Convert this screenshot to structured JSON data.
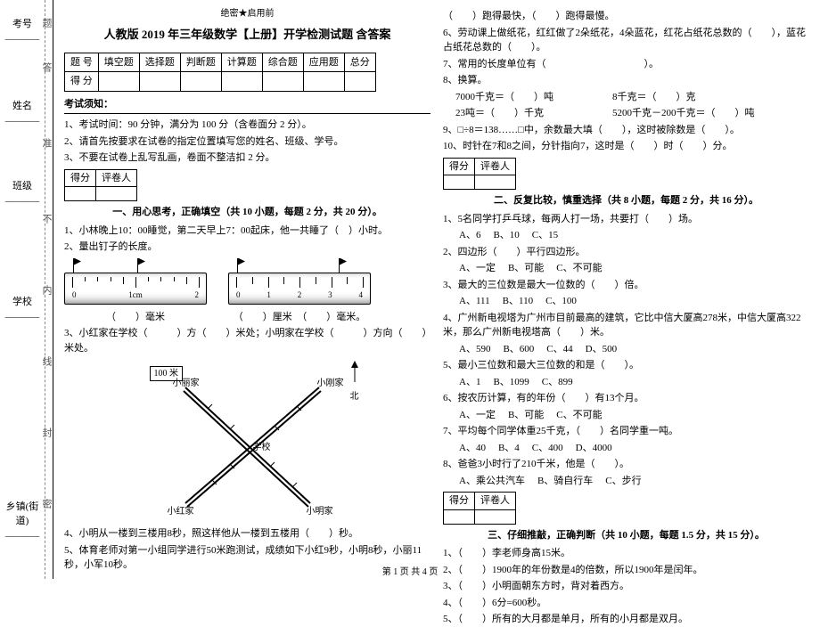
{
  "binding": {
    "labels": [
      "考号",
      "姓名",
      "班级",
      "学校",
      "乡镇(街道)"
    ],
    "cutchars": [
      "题",
      "答",
      "准",
      "不",
      "内",
      "线",
      "封",
      "密"
    ]
  },
  "secret": "绝密★启用前",
  "title": "人教版 2019 年三年级数学【上册】开学检测试题 含答案",
  "score_header": [
    "题 号",
    "填空题",
    "选择题",
    "判断题",
    "计算题",
    "综合题",
    "应用题",
    "总分"
  ],
  "score_row_label": "得 分",
  "notice_title": "考试须知：",
  "notice": [
    "1、考试时间：90 分钟，满分为 100 分（含卷面分 2 分）。",
    "2、请首先按要求在试卷的指定位置填写您的姓名、班级、学号。",
    "3、不要在试卷上乱写乱画，卷面不整洁扣 2 分。"
  ],
  "markbox": {
    "c1": "得分",
    "c2": "评卷人"
  },
  "sec1": {
    "title": "一、用心思考，正确填空（共 10 小题，每题 2 分，共 20 分）。",
    "q1": "1、小林晚上10：00睡觉，第二天早上7：00起床，他一共睡了（　）小时。",
    "q2": "2、量出钉子的长度。",
    "ruler1_labels": [
      "0",
      "1cm",
      "2"
    ],
    "ruler2_labels": [
      "0",
      "1",
      "2",
      "3",
      "4"
    ],
    "cap1": "（　　）毫米",
    "cap2a": "（　　）厘米",
    "cap2b": "（　　）毫米。",
    "q3": "3、小红家在学校（　　　）方（　　）米处；小明家在学校（　　　）方向（　　）米处。",
    "diagram": {
      "scale": "100 米",
      "n1": "小丽家",
      "n2": "小刚家",
      "n3": "小红家",
      "n4": "小明家",
      "center": "学校",
      "north": "北"
    },
    "q4": "4、小明从一楼到三楼用8秒，照这样他从一楼到五楼用（　　）秒。",
    "q5": "5、体育老师对第一小组同学进行50米跑测试，成绩如下小红9秒，小明8秒，小丽11秒，小军10秒。"
  },
  "col2": {
    "l1": "（　　）跑得最快，（　　）跑得最慢。",
    "l2": "6、劳动课上做纸花，红红做了2朵纸花，4朵蓝花，红花占纸花总数的（　　），蓝花占纸花总数的（　　）。",
    "l3": "7、常用的长度单位有（　　　　　　　　　　）。",
    "l4": "8、换算。",
    "l4a": "7000千克＝（　　）吨　　　　　　8千克＝（　　）克",
    "l4b": "23吨＝（　　）千克　　　　　　　5200千克－200千克＝（　　）吨",
    "l5": "9、□÷8＝138……□中，余数最大填（　　），这时被除数是（　　）。",
    "l6": "10、时针在7和8之间，分针指向7，这时是（　　）时（　　）分。"
  },
  "sec2": {
    "title": "二、反复比较，慎重选择（共 8 小题，每题 2 分，共 16 分）。",
    "q1": "1、5名同学打乒乓球，每两人打一场，共要打（　　）场。",
    "q1o": [
      "A、6",
      "B、10",
      "C、15"
    ],
    "q2": "2、四边形（　　）平行四边形。",
    "q2o": [
      "A、一定",
      "B、可能",
      "C、不可能"
    ],
    "q3": "3、最大的三位数是最大一位数的（　　）倍。",
    "q3o": [
      "A、111",
      "B、110",
      "C、100"
    ],
    "q4": "4、广州新电视塔为广州市目前最高的建筑，它比中信大厦高278米，中信大厦高322米，那么广州新电视塔高（　　）米。",
    "q4o": [
      "A、590",
      "B、600",
      "C、44",
      "D、500"
    ],
    "q5": "5、最小三位数和最大三位数的和是（　　）。",
    "q5o": [
      "A、1",
      "B、1099",
      "C、899"
    ],
    "q6": "6、按农历计算，有的年份（　　）有13个月。",
    "q6o": [
      "A、一定",
      "B、可能",
      "C、不可能"
    ],
    "q7": "7、平均每个同学体重25千克，（　　）名同学重一吨。",
    "q7o": [
      "A、40",
      "B、4",
      "C、400",
      "D、4000"
    ],
    "q8": "8、爸爸3小时行了210千米，他是（　　）。",
    "q8o": [
      "A、乘公共汽车",
      "B、骑自行车",
      "C、步行"
    ]
  },
  "sec3": {
    "title": "三、仔细推敲，正确判断（共 10 小题，每题 1.5 分，共 15 分）。",
    "q1": "1、（　　）李老师身高15米。",
    "q2": "2、（　　）1900年的年份数是4的倍数，所以1900年是闰年。",
    "q3": "3、（　　）小明面朝东方时，背对着西方。",
    "q4": "4、（　　）6分=600秒。",
    "q5": "5、（　　）所有的大月都是单月，所有的小月都是双月。"
  },
  "footer": "第 1 页 共 4 页"
}
